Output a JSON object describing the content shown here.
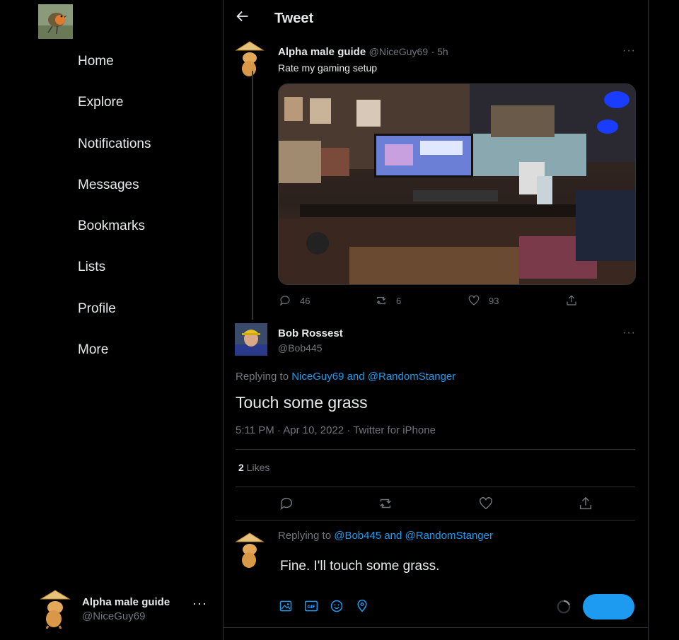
{
  "sidebar": {
    "nav": [
      "Home",
      "Explore",
      "Notifications",
      "Messages",
      "Bookmarks",
      "Lists",
      "Profile",
      "More"
    ],
    "account": {
      "name": "Alpha male guide",
      "handle": "@NiceGuy69",
      "more": "···"
    }
  },
  "header": {
    "title": "Tweet"
  },
  "original_tweet": {
    "name": "Alpha male guide",
    "handle": "@NiceGuy69",
    "time": "· 5h",
    "text": "Rate my gaming setup",
    "more": "···",
    "replies": "46",
    "retweets": "6",
    "likes": "93"
  },
  "focused_tweet": {
    "name": "Bob Rossest",
    "handle": "@Bob445",
    "more": "···",
    "replying_prefix": "Replying to ",
    "replying_users": "NiceGuy69 and @RandomStanger",
    "text": "Touch some grass",
    "meta": "5:11 PM · Apr 10, 2022 · Twitter for iPhone",
    "like_count": "2",
    "like_label": " Likes"
  },
  "reply_composer": {
    "replying_prefix": "Replying to ",
    "replying_users": "@Bob445 and @RandomStanger",
    "draft_text": "Fine. I'll touch some grass.",
    "button_label": ""
  },
  "colors": {
    "accent": "#1d9bf0",
    "background": "#000000",
    "muted": "#71767b",
    "border": "#2f3336"
  }
}
